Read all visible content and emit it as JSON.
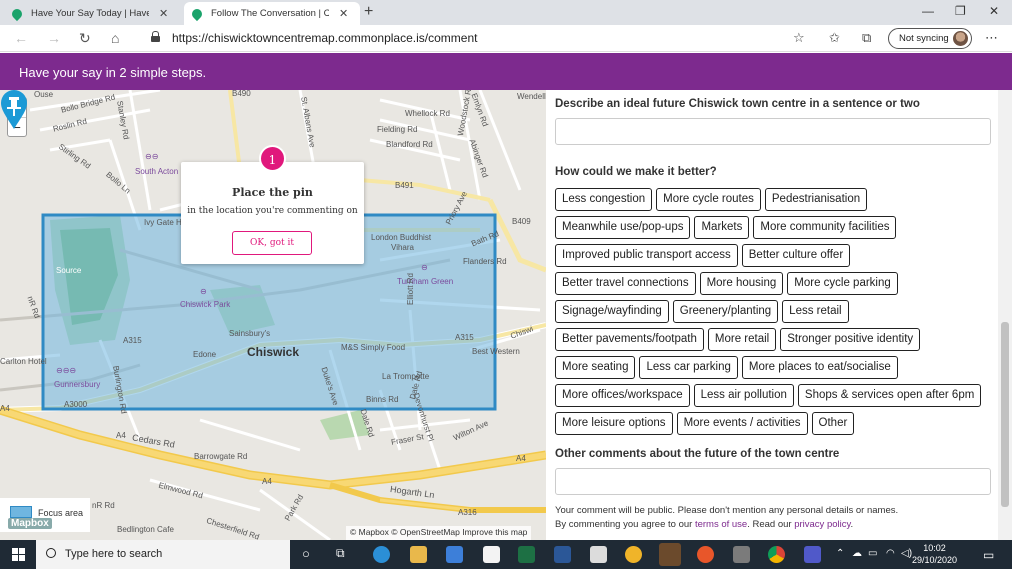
{
  "browser": {
    "tabs": [
      {
        "label": "Have Your Say Today | Have Your",
        "active": false
      },
      {
        "label": "Follow The Conversation | Chisw",
        "active": true
      }
    ],
    "url": "https://chiswicktowncentremap.commonplace.is/comment",
    "sync_label": "Not syncing"
  },
  "banner": {
    "text": "Have your say in 2 simple steps."
  },
  "map": {
    "popup": {
      "step": "1",
      "title": "Place the pin",
      "text": "in the location you're commenting on",
      "button": "OK, got it"
    },
    "labels": {
      "chiswick": "Chiswick",
      "bollo_bridge_rd": "Bollo Bridge Rd",
      "roslin_rd": "Roslin Rd",
      "stirling_rd": "Stirling Rd",
      "south_acton": "South Acton",
      "bollo_ln": "Bollo Ln",
      "ivy_gate": "Ivy Gate H",
      "whellock_rd": "Whellock Rd",
      "fielding_rd": "Fielding Rd",
      "blandford_rd": "Blandford Rd",
      "b490": "B490",
      "b491": "B491",
      "b409": "B409",
      "london_buddhist": "London Buddhist",
      "vihara": "Vihara",
      "bath_rd": "Bath Rd",
      "flanders_rd": "Flanders Rd",
      "turnham_green": "Turnham Green",
      "chiswick_park": "Chiswick Park",
      "sainsburys": "Sainsbury's",
      "edone": "Edone",
      "ms_simply_food": "M&S Simply Food",
      "best_western": "Best Western",
      "la_trompette": "La Trompette",
      "gunnersbury": "Gunnersbury",
      "carlton_hotel": "Carlton Hotel",
      "source": "Source",
      "a315": "A315",
      "a3000": "A3000",
      "a4": "A4",
      "a316": "A316",
      "cedars_rd": "Cedars Rd",
      "barrowgate_rd": "Barrowgate Rd",
      "elmwood_rd": "Elmwood Rd",
      "hogarth_ln": "Hogarth Ln",
      "chesterfield_rd": "Chesterfield Rd",
      "bedlington_cafe": "Bedlington Cafe",
      "park_rd": "Park Rd",
      "fraser_st": "Fraser St",
      "wilton_ave": "Wilton Ave",
      "dukes_ave": "Duke's Ave",
      "dale_rd": "Dale Rd",
      "elliott_rd": "Elliott Rd",
      "burlington_rd": "Burlington Rd",
      "binns_rd": "Binns Rd",
      "devonhurst_pl": "Devonhurst Pl",
      "st_albans_ave": "St. Albans Ave",
      "stanley_rd": "Stanley Rd",
      "woodstock_rd": "Woodstock Rd",
      "abinger_rd": "Abinger Rd",
      "emlyn_rd": "Emlyn Rd",
      "priory_ave": "Priory Ave",
      "nr_rd": "nR Rd",
      "ouse": "Ouse",
      "wendell": "Wendell"
    },
    "legend_label": "Focus area",
    "mapbox_logo": "Mapbox",
    "attribution": "© Mapbox © OpenStreetMap Improve this map",
    "colors": {
      "focus_fill": "#6fb6e0",
      "focus_border": "#2f8ac4",
      "pin": "#1c9ad6",
      "accent": "#e0187c"
    }
  },
  "form": {
    "q1": "Describe an ideal future Chiswick town centre in a sentence or two",
    "q2": "How could we make it better?",
    "tag_rows": [
      [
        "Less congestion",
        "More cycle routes",
        "Pedestrianisation"
      ],
      [
        "Meanwhile use/pop-ups",
        "Markets",
        "More community facilities"
      ],
      [
        "Improved public transport access",
        "Better culture offer"
      ],
      [
        "Better travel connections",
        "More housing",
        "More cycle parking"
      ],
      [
        "Signage/wayfinding",
        "Greenery/planting",
        "Less retail"
      ],
      [
        "Better pavements/footpath",
        "More retail",
        "Stronger positive identity"
      ],
      [
        "More seating",
        "Less car parking",
        "More places to eat/socialise"
      ],
      [
        "More offices/workspace",
        "Less air pollution",
        "Shops & services open after 6pm"
      ],
      [
        "More leisure options",
        "More events / activities",
        "Other"
      ]
    ],
    "q3": "Other comments about the future of the town centre",
    "note_line1": "Your comment will be public. Please don't mention any personal details or names.",
    "note_line2_pre": "By commenting you agree to our ",
    "terms": "terms of use",
    "note_line2_mid": ". Read our ",
    "privacy": "privacy policy",
    "note_line2_post": "."
  },
  "taskbar": {
    "search_placeholder": "Type here to search",
    "time": "10:02",
    "date": "29/10/2020"
  }
}
